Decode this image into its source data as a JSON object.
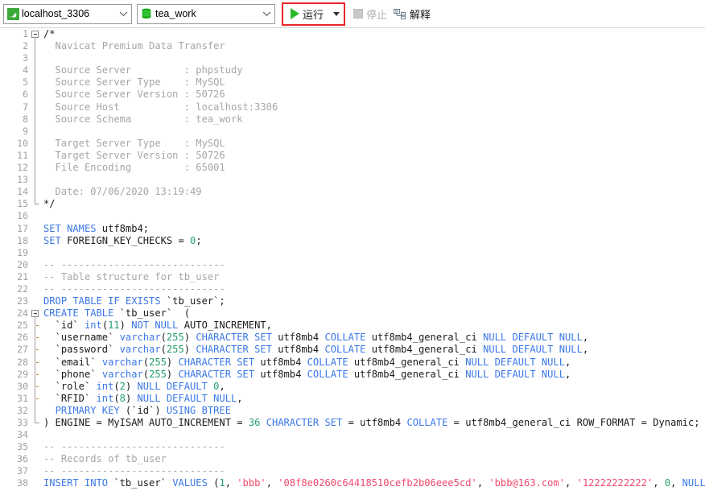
{
  "toolbar": {
    "connection": {
      "icon": "mysql-dolphin-icon",
      "value": "localhost_3306",
      "caret": "chevron-down-icon"
    },
    "database": {
      "icon": "database-cylinder-icon",
      "value": "tea_work",
      "caret": "chevron-down-icon"
    },
    "run": {
      "label": "运行",
      "icon": "play-icon",
      "dropdown": "chevron-down-icon",
      "highlight_color": "#e8262a"
    },
    "stop": {
      "label": "停止",
      "icon": "stop-square-icon",
      "disabled": true
    },
    "explain": {
      "label": "解释",
      "icon": "explain-plan-icon"
    }
  },
  "editor": {
    "language": "sql",
    "colors": {
      "comment": "#a6a6a6",
      "keyword": "#3b78e7",
      "number": "#22a06b",
      "string": "#f0496b",
      "plain": "#1b1b1b",
      "gutter": "#a0a0a0",
      "background": "#ffffff"
    },
    "lines": [
      {
        "n": 1,
        "fold": "start",
        "tokens": [
          [
            "pln",
            "/*"
          ]
        ]
      },
      {
        "n": 2,
        "fold": "mid",
        "tokens": [
          [
            "cmt",
            "  Navicat Premium Data Transfer"
          ]
        ]
      },
      {
        "n": 3,
        "fold": "mid",
        "tokens": []
      },
      {
        "n": 4,
        "fold": "mid",
        "tokens": [
          [
            "cmt",
            "  Source Server         : phpstudy"
          ]
        ]
      },
      {
        "n": 5,
        "fold": "mid",
        "tokens": [
          [
            "cmt",
            "  Source Server Type    : MySQL"
          ]
        ]
      },
      {
        "n": 6,
        "fold": "mid",
        "tokens": [
          [
            "cmt",
            "  Source Server Version : 50726"
          ]
        ]
      },
      {
        "n": 7,
        "fold": "mid",
        "tokens": [
          [
            "cmt",
            "  Source Host           : localhost:3306"
          ]
        ]
      },
      {
        "n": 8,
        "fold": "mid",
        "tokens": [
          [
            "cmt",
            "  Source Schema         : tea_work"
          ]
        ]
      },
      {
        "n": 9,
        "fold": "mid",
        "tokens": []
      },
      {
        "n": 10,
        "fold": "mid",
        "tokens": [
          [
            "cmt",
            "  Target Server Type    : MySQL"
          ]
        ]
      },
      {
        "n": 11,
        "fold": "mid",
        "tokens": [
          [
            "cmt",
            "  Target Server Version : 50726"
          ]
        ]
      },
      {
        "n": 12,
        "fold": "mid",
        "tokens": [
          [
            "cmt",
            "  File Encoding         : 65001"
          ]
        ]
      },
      {
        "n": 13,
        "fold": "mid",
        "tokens": []
      },
      {
        "n": 14,
        "fold": "mid",
        "tokens": [
          [
            "cmt",
            "  Date: 07/06/2020 13:19:49"
          ]
        ]
      },
      {
        "n": 15,
        "fold": "end",
        "tokens": [
          [
            "pln",
            "*/"
          ]
        ]
      },
      {
        "n": 16,
        "fold": "none",
        "tokens": []
      },
      {
        "n": 17,
        "fold": "none",
        "tokens": [
          [
            "kw",
            "SET NAMES"
          ],
          [
            "pln",
            " utf8mb4;"
          ]
        ]
      },
      {
        "n": 18,
        "fold": "none",
        "tokens": [
          [
            "kw",
            "SET"
          ],
          [
            "pln",
            " FOREIGN_KEY_CHECKS = "
          ],
          [
            "num",
            "0"
          ],
          [
            "pln",
            ";"
          ]
        ]
      },
      {
        "n": 19,
        "fold": "none",
        "tokens": []
      },
      {
        "n": 20,
        "fold": "none",
        "tokens": [
          [
            "cmt",
            "-- ----------------------------"
          ]
        ]
      },
      {
        "n": 21,
        "fold": "none",
        "tokens": [
          [
            "cmt",
            "-- Table structure for tb_user"
          ]
        ]
      },
      {
        "n": 22,
        "fold": "none",
        "tokens": [
          [
            "cmt",
            "-- ----------------------------"
          ]
        ]
      },
      {
        "n": 23,
        "fold": "none",
        "tokens": [
          [
            "kw",
            "DROP TABLE IF EXISTS"
          ],
          [
            "pln",
            " `tb_user`;"
          ]
        ]
      },
      {
        "n": 24,
        "fold": "start",
        "tokens": [
          [
            "kw",
            "CREATE TABLE"
          ],
          [
            "pln",
            " `tb_user`  ("
          ]
        ]
      },
      {
        "n": 25,
        "fold": "tick",
        "tokens": [
          [
            "pln",
            "  `id` "
          ],
          [
            "kw",
            "int"
          ],
          [
            "pln",
            "("
          ],
          [
            "num",
            "11"
          ],
          [
            "pln",
            ") "
          ],
          [
            "kw",
            "NOT NULL"
          ],
          [
            "pln",
            " AUTO_INCREMENT,"
          ]
        ]
      },
      {
        "n": 26,
        "fold": "tick",
        "tokens": [
          [
            "pln",
            "  `username` "
          ],
          [
            "kw",
            "varchar"
          ],
          [
            "pln",
            "("
          ],
          [
            "num",
            "255"
          ],
          [
            "pln",
            ") "
          ],
          [
            "kw",
            "CHARACTER SET"
          ],
          [
            "pln",
            " utf8mb4 "
          ],
          [
            "kw",
            "COLLATE"
          ],
          [
            "pln",
            " utf8mb4_general_ci "
          ],
          [
            "kw",
            "NULL DEFAULT NULL"
          ],
          [
            "pln",
            ","
          ]
        ]
      },
      {
        "n": 27,
        "fold": "tick",
        "tokens": [
          [
            "pln",
            "  `password` "
          ],
          [
            "kw",
            "varchar"
          ],
          [
            "pln",
            "("
          ],
          [
            "num",
            "255"
          ],
          [
            "pln",
            ") "
          ],
          [
            "kw",
            "CHARACTER SET"
          ],
          [
            "pln",
            " utf8mb4 "
          ],
          [
            "kw",
            "COLLATE"
          ],
          [
            "pln",
            " utf8mb4_general_ci "
          ],
          [
            "kw",
            "NULL DEFAULT NULL"
          ],
          [
            "pln",
            ","
          ]
        ]
      },
      {
        "n": 28,
        "fold": "tick",
        "tokens": [
          [
            "pln",
            "  `email` "
          ],
          [
            "kw",
            "varchar"
          ],
          [
            "pln",
            "("
          ],
          [
            "num",
            "255"
          ],
          [
            "pln",
            ") "
          ],
          [
            "kw",
            "CHARACTER SET"
          ],
          [
            "pln",
            " utf8mb4 "
          ],
          [
            "kw",
            "COLLATE"
          ],
          [
            "pln",
            " utf8mb4_general_ci "
          ],
          [
            "kw",
            "NULL DEFAULT NULL"
          ],
          [
            "pln",
            ","
          ]
        ]
      },
      {
        "n": 29,
        "fold": "tick",
        "tokens": [
          [
            "pln",
            "  `phone` "
          ],
          [
            "kw",
            "varchar"
          ],
          [
            "pln",
            "("
          ],
          [
            "num",
            "255"
          ],
          [
            "pln",
            ") "
          ],
          [
            "kw",
            "CHARACTER SET"
          ],
          [
            "pln",
            " utf8mb4 "
          ],
          [
            "kw",
            "COLLATE"
          ],
          [
            "pln",
            " utf8mb4_general_ci "
          ],
          [
            "kw",
            "NULL DEFAULT NULL"
          ],
          [
            "pln",
            ","
          ]
        ]
      },
      {
        "n": 30,
        "fold": "tick",
        "tokens": [
          [
            "pln",
            "  `role` "
          ],
          [
            "kw",
            "int"
          ],
          [
            "pln",
            "("
          ],
          [
            "num",
            "2"
          ],
          [
            "pln",
            ") "
          ],
          [
            "kw",
            "NULL DEFAULT"
          ],
          [
            "pln",
            " "
          ],
          [
            "num",
            "0"
          ],
          [
            "pln",
            ","
          ]
        ]
      },
      {
        "n": 31,
        "fold": "tick",
        "tokens": [
          [
            "pln",
            "  `RFID` "
          ],
          [
            "kw",
            "int"
          ],
          [
            "pln",
            "("
          ],
          [
            "num",
            "8"
          ],
          [
            "pln",
            ") "
          ],
          [
            "kw",
            "NULL DEFAULT NULL"
          ],
          [
            "pln",
            ","
          ]
        ]
      },
      {
        "n": 32,
        "fold": "mid",
        "tokens": [
          [
            "pln",
            "  "
          ],
          [
            "kw",
            "PRIMARY KEY"
          ],
          [
            "pln",
            " (`id`) "
          ],
          [
            "kw",
            "USING BTREE"
          ]
        ]
      },
      {
        "n": 33,
        "fold": "end",
        "tokens": [
          [
            "pln",
            ") ENGINE = MyISAM AUTO_INCREMENT = "
          ],
          [
            "num",
            "36"
          ],
          [
            "pln",
            " "
          ],
          [
            "kw",
            "CHARACTER SET"
          ],
          [
            "pln",
            " = utf8mb4 "
          ],
          [
            "kw",
            "COLLATE"
          ],
          [
            "pln",
            " = utf8mb4_general_ci ROW_FORMAT = Dynamic;"
          ]
        ]
      },
      {
        "n": 34,
        "fold": "none",
        "tokens": []
      },
      {
        "n": 35,
        "fold": "none",
        "tokens": [
          [
            "cmt",
            "-- ----------------------------"
          ]
        ]
      },
      {
        "n": 36,
        "fold": "none",
        "tokens": [
          [
            "cmt",
            "-- Records of tb_user"
          ]
        ]
      },
      {
        "n": 37,
        "fold": "none",
        "tokens": [
          [
            "cmt",
            "-- ----------------------------"
          ]
        ]
      },
      {
        "n": 38,
        "fold": "none",
        "tokens": [
          [
            "kw",
            "INSERT INTO"
          ],
          [
            "pln",
            " `tb_user` "
          ],
          [
            "kw",
            "VALUES"
          ],
          [
            "pln",
            " ("
          ],
          [
            "num",
            "1"
          ],
          [
            "pln",
            ", "
          ],
          [
            "str",
            "'bbb'"
          ],
          [
            "pln",
            ", "
          ],
          [
            "str",
            "'08f8e0260c64418510cefb2b06eee5cd'"
          ],
          [
            "pln",
            ", "
          ],
          [
            "str",
            "'bbb@163.com'"
          ],
          [
            "pln",
            ", "
          ],
          [
            "str",
            "'12222222222'"
          ],
          [
            "pln",
            ", "
          ],
          [
            "num",
            "0"
          ],
          [
            "pln",
            ", "
          ],
          [
            "kw",
            "NULL"
          ],
          [
            "pln",
            ");"
          ]
        ]
      }
    ]
  }
}
